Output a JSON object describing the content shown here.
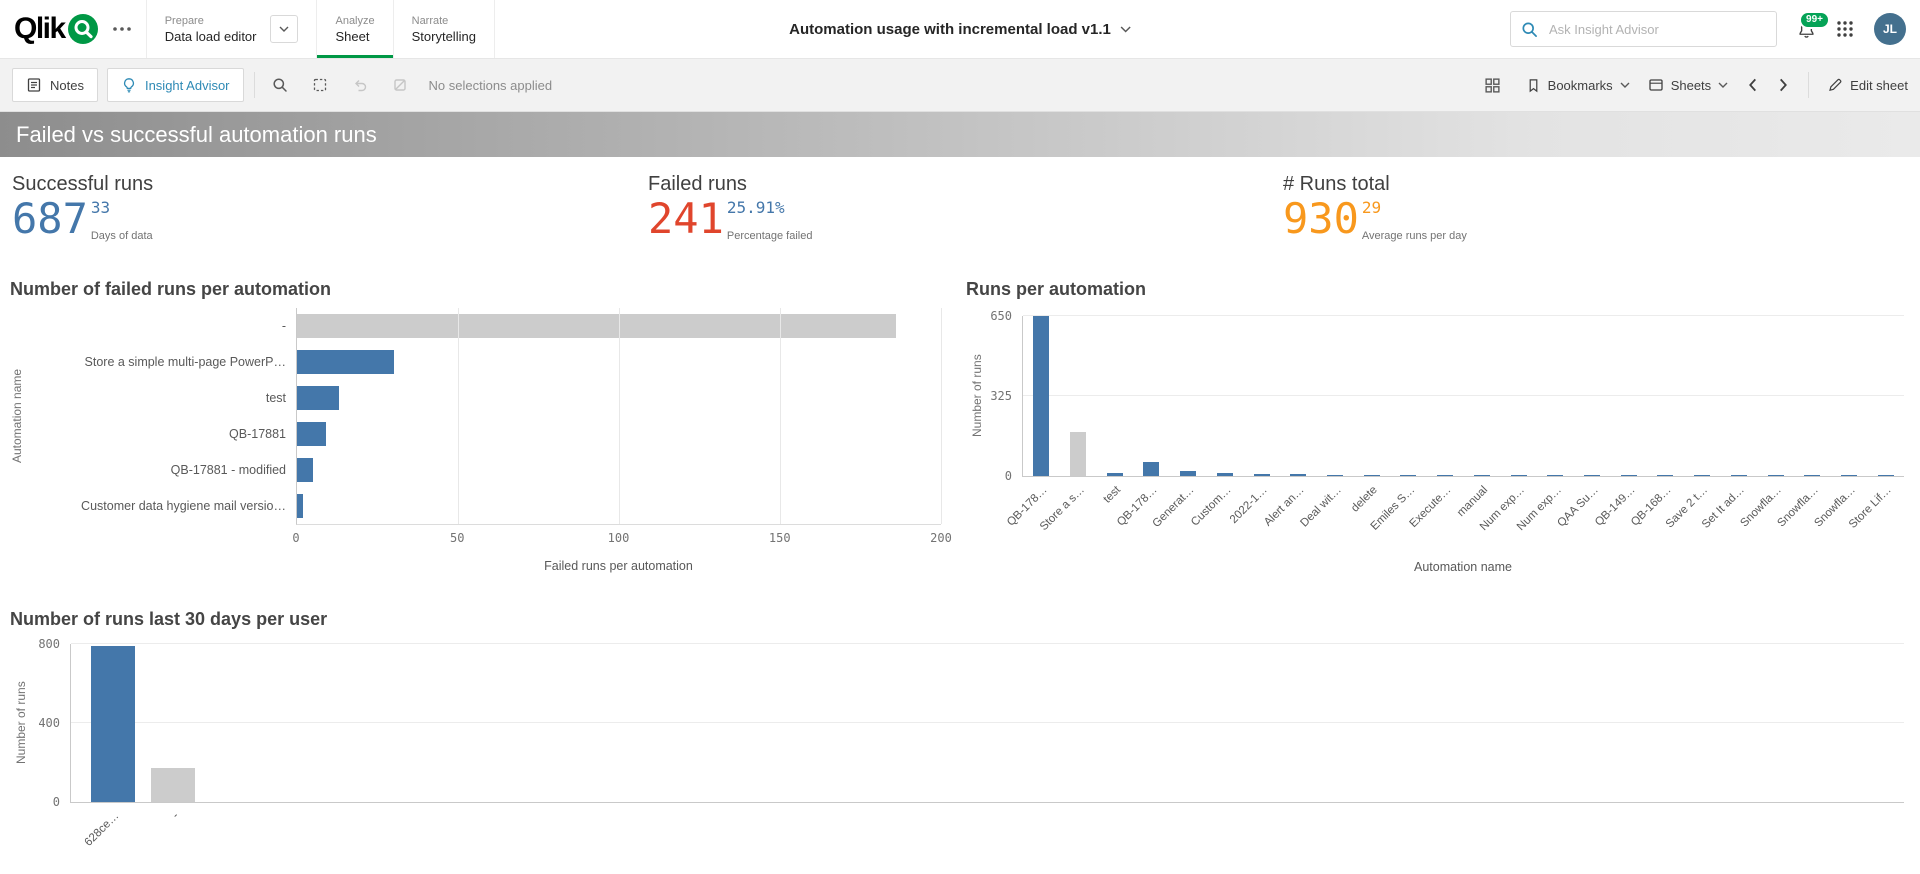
{
  "topbar": {
    "logo": "Qlik",
    "nav": [
      {
        "label": "Prepare",
        "sub": "Data load editor"
      },
      {
        "label": "Analyze",
        "sub": "Sheet"
      },
      {
        "label": "Narrate",
        "sub": "Storytelling"
      }
    ],
    "app_title": "Automation usage with incremental load v1.1",
    "search_placeholder": "Ask Insight Advisor",
    "notifications": "99+",
    "avatar": "JL"
  },
  "toolbar": {
    "notes_label": "Notes",
    "insight_label": "Insight Advisor",
    "selections_status": "No selections applied",
    "bookmarks_label": "Bookmarks",
    "sheets_label": "Sheets",
    "edit_label": "Edit sheet"
  },
  "sheet": {
    "title": "Failed vs successful automation runs"
  },
  "kpis": [
    {
      "title": "Successful runs",
      "value": "687",
      "sub_value": "33",
      "sub_label": "Days of data",
      "color": "#4477aa",
      "sub_color": "#4477aa"
    },
    {
      "title": "Failed runs",
      "value": "241",
      "sub_value": "25.91%",
      "sub_label": "Percentage failed",
      "color": "#e0452c",
      "sub_color": "#4477aa"
    },
    {
      "title": "# Runs total",
      "value": "930",
      "sub_value": "29",
      "sub_label": "Average runs per day",
      "color": "#f8981d",
      "sub_color": "#f8981d"
    }
  ],
  "colors": {
    "brand": "#009845",
    "insight": "#2e8ab5",
    "badge": "#05a357",
    "avatar": "#44708e",
    "bar_blue": "#4477aa",
    "bar_gray": "#cccccc"
  },
  "chart_data": [
    {
      "type": "bar",
      "orientation": "horizontal",
      "title": "Number of failed runs per automation",
      "xlabel": "Failed runs per automation",
      "ylabel": "Automation name",
      "categories": [
        "-",
        "Store a simple multi-page PowerP…",
        "test",
        "QB-17881",
        "QB-17881 - modified",
        "Customer data hygiene mail versio…"
      ],
      "values": [
        186,
        30,
        13,
        9,
        5,
        2
      ],
      "colors": [
        "#cccccc",
        "#4477aa",
        "#4477aa",
        "#4477aa",
        "#4477aa",
        "#4477aa"
      ],
      "xticks": [
        0,
        50,
        100,
        150,
        200
      ],
      "xlim": [
        0,
        200
      ],
      "grid": "vertical"
    },
    {
      "type": "bar",
      "orientation": "vertical",
      "title": "Runs per automation",
      "xlabel": "Automation name",
      "ylabel": "Number of runs",
      "categories": [
        "QB-178…",
        "Store a s…",
        "test",
        "QB-178…",
        "Generat…",
        "Custom…",
        "2022-1…",
        "Alert an…",
        "Deal wit…",
        "delete",
        "Emiles S…",
        "Execute…",
        "manual",
        "Num exp…",
        "Num exp…",
        "QAA Su…",
        "QB-149…",
        "QB-168…",
        "Save 2 t…",
        "Set It ad…",
        "Snowfla…",
        "Snowfla…",
        "Snowfla…",
        "Store Lif…"
      ],
      "values": [
        650,
        180,
        12,
        55,
        22,
        14,
        9,
        7,
        6,
        5,
        5,
        4,
        4,
        3,
        3,
        3,
        2,
        2,
        2,
        2,
        1,
        1,
        1,
        1
      ],
      "color": "#4477aa",
      "colors": {
        "1": "#cccccc"
      },
      "yticks": [
        0,
        325,
        650
      ],
      "ylim": [
        0,
        650
      ],
      "grid": "horizontal"
    },
    {
      "type": "bar",
      "orientation": "vertical",
      "title": "Number of runs last 30 days per user",
      "xlabel": "",
      "ylabel": "Number of runs",
      "categories": [
        "628ce…",
        "-"
      ],
      "values": [
        790,
        170
      ],
      "color": "#4477aa",
      "colors": {
        "0": "#4477aa",
        "1": "#cccccc"
      },
      "yticks": [
        0,
        400,
        800
      ],
      "ylim": [
        0,
        800
      ],
      "grid": "horizontal"
    }
  ]
}
